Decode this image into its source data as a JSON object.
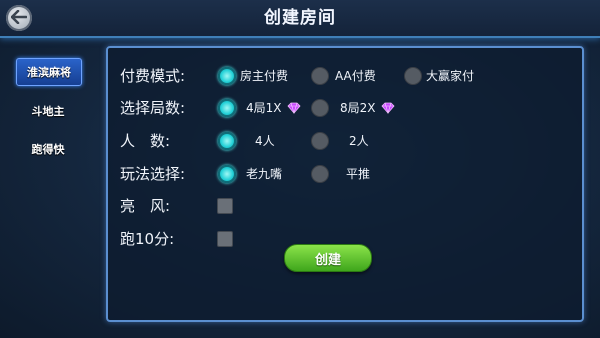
{
  "header": {
    "title": "创建房间",
    "back_icon": "back-arrow-icon"
  },
  "sidebar": {
    "items": [
      {
        "label": "淮滨麻将",
        "active": true
      },
      {
        "label": "斗地主",
        "active": false
      },
      {
        "label": "跑得快",
        "active": false
      }
    ]
  },
  "form": {
    "payment": {
      "label": "付费模式:",
      "options": [
        "房主付费",
        "AA付费",
        "大赢家付"
      ],
      "selected": "房主付费"
    },
    "rounds": {
      "label": "选择局数:",
      "options": [
        "4局1X",
        "8局2X"
      ],
      "selected": "4局1X",
      "icon": "gem-icon"
    },
    "players": {
      "label": "人　数:",
      "options": [
        "4人",
        "2人"
      ],
      "selected": "4人"
    },
    "play_mode": {
      "label": "玩法选择:",
      "options": [
        "老九嘴",
        "平推"
      ],
      "selected": "老九嘴"
    },
    "liang_feng": {
      "label": "亮　风:",
      "checked": false
    },
    "pao10": {
      "label": "跑10分:",
      "checked": false
    }
  },
  "actions": {
    "create_label": "创建"
  },
  "colors": {
    "accent_cyan": "#23d1d7",
    "create_green": "#5cc12d",
    "panel_border": "#5b8fd0",
    "active_tab": "#2a63c9"
  }
}
